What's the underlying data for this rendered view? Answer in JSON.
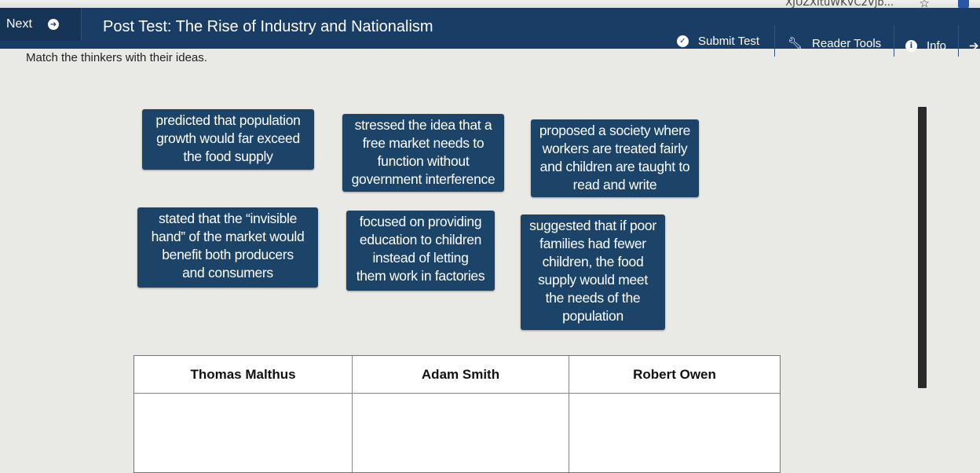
{
  "browser": {
    "url_fragment": "XJUZXItuWKVC2Vjb..."
  },
  "header": {
    "next_label": "Next",
    "title": "Post Test: The Rise of Industry and Nationalism",
    "submit_label": "Submit Test",
    "reader_tools_label": "Reader Tools",
    "info_label": "Info"
  },
  "colors": {
    "header_bg": "#1a3d66",
    "card_bg": "#1c4468",
    "page_bg": "#e9e9e6"
  },
  "question": {
    "instructions": "Match the thinkers with their ideas."
  },
  "cards": [
    {
      "lines": [
        "predicted that population",
        "growth would far exceed",
        "the food supply"
      ]
    },
    {
      "lines": [
        "stressed the idea that a",
        "free market needs to",
        "function without",
        "government interference"
      ]
    },
    {
      "lines": [
        "proposed a society where",
        "workers are treated fairly",
        "and children are taught to",
        "read and write"
      ]
    },
    {
      "lines": [
        "stated that the “invisible",
        "hand” of the market would",
        "benefit both producers",
        "and consumers"
      ]
    },
    {
      "lines": [
        "focused on providing",
        "education to children",
        "instead of letting",
        "them work in factories"
      ]
    },
    {
      "lines": [
        "suggested that if poor",
        "families had fewer",
        "children, the food",
        "supply would meet",
        "the needs of the",
        "population"
      ]
    }
  ],
  "table": {
    "columns": [
      "Thomas Malthus",
      "Adam Smith",
      "Robert Owen"
    ]
  }
}
